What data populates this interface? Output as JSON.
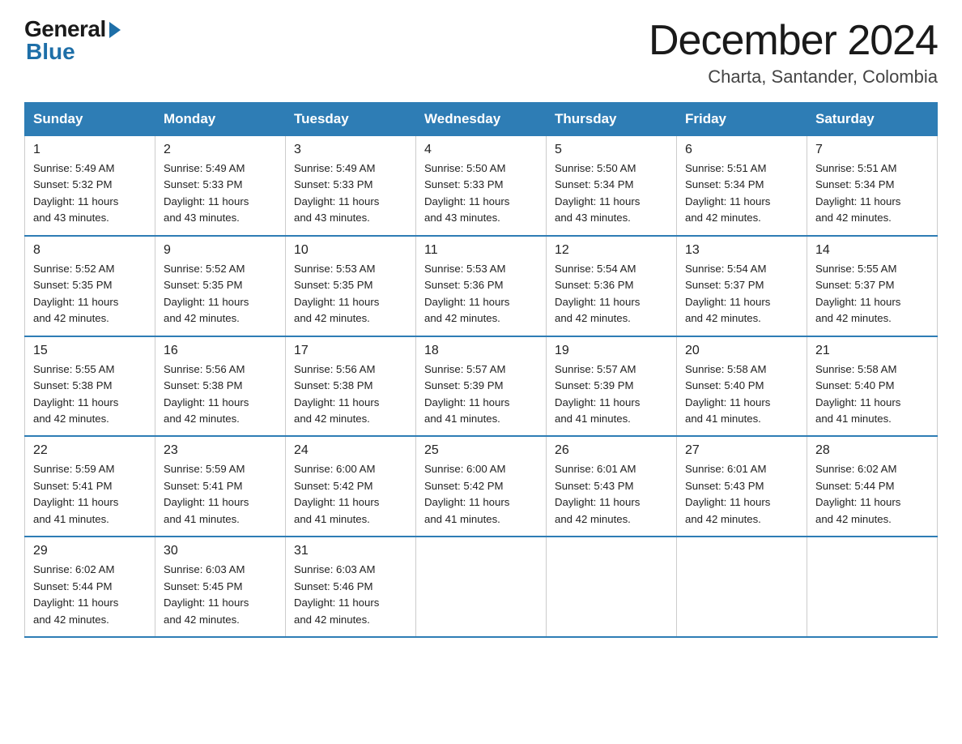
{
  "logo": {
    "general": "General",
    "blue": "Blue"
  },
  "title": "December 2024",
  "subtitle": "Charta, Santander, Colombia",
  "headers": [
    "Sunday",
    "Monday",
    "Tuesday",
    "Wednesday",
    "Thursday",
    "Friday",
    "Saturday"
  ],
  "weeks": [
    [
      {
        "day": "1",
        "sunrise": "5:49 AM",
        "sunset": "5:32 PM",
        "daylight": "11 hours and 43 minutes."
      },
      {
        "day": "2",
        "sunrise": "5:49 AM",
        "sunset": "5:33 PM",
        "daylight": "11 hours and 43 minutes."
      },
      {
        "day": "3",
        "sunrise": "5:49 AM",
        "sunset": "5:33 PM",
        "daylight": "11 hours and 43 minutes."
      },
      {
        "day": "4",
        "sunrise": "5:50 AM",
        "sunset": "5:33 PM",
        "daylight": "11 hours and 43 minutes."
      },
      {
        "day": "5",
        "sunrise": "5:50 AM",
        "sunset": "5:34 PM",
        "daylight": "11 hours and 43 minutes."
      },
      {
        "day": "6",
        "sunrise": "5:51 AM",
        "sunset": "5:34 PM",
        "daylight": "11 hours and 42 minutes."
      },
      {
        "day": "7",
        "sunrise": "5:51 AM",
        "sunset": "5:34 PM",
        "daylight": "11 hours and 42 minutes."
      }
    ],
    [
      {
        "day": "8",
        "sunrise": "5:52 AM",
        "sunset": "5:35 PM",
        "daylight": "11 hours and 42 minutes."
      },
      {
        "day": "9",
        "sunrise": "5:52 AM",
        "sunset": "5:35 PM",
        "daylight": "11 hours and 42 minutes."
      },
      {
        "day": "10",
        "sunrise": "5:53 AM",
        "sunset": "5:35 PM",
        "daylight": "11 hours and 42 minutes."
      },
      {
        "day": "11",
        "sunrise": "5:53 AM",
        "sunset": "5:36 PM",
        "daylight": "11 hours and 42 minutes."
      },
      {
        "day": "12",
        "sunrise": "5:54 AM",
        "sunset": "5:36 PM",
        "daylight": "11 hours and 42 minutes."
      },
      {
        "day": "13",
        "sunrise": "5:54 AM",
        "sunset": "5:37 PM",
        "daylight": "11 hours and 42 minutes."
      },
      {
        "day": "14",
        "sunrise": "5:55 AM",
        "sunset": "5:37 PM",
        "daylight": "11 hours and 42 minutes."
      }
    ],
    [
      {
        "day": "15",
        "sunrise": "5:55 AM",
        "sunset": "5:38 PM",
        "daylight": "11 hours and 42 minutes."
      },
      {
        "day": "16",
        "sunrise": "5:56 AM",
        "sunset": "5:38 PM",
        "daylight": "11 hours and 42 minutes."
      },
      {
        "day": "17",
        "sunrise": "5:56 AM",
        "sunset": "5:38 PM",
        "daylight": "11 hours and 42 minutes."
      },
      {
        "day": "18",
        "sunrise": "5:57 AM",
        "sunset": "5:39 PM",
        "daylight": "11 hours and 41 minutes."
      },
      {
        "day": "19",
        "sunrise": "5:57 AM",
        "sunset": "5:39 PM",
        "daylight": "11 hours and 41 minutes."
      },
      {
        "day": "20",
        "sunrise": "5:58 AM",
        "sunset": "5:40 PM",
        "daylight": "11 hours and 41 minutes."
      },
      {
        "day": "21",
        "sunrise": "5:58 AM",
        "sunset": "5:40 PM",
        "daylight": "11 hours and 41 minutes."
      }
    ],
    [
      {
        "day": "22",
        "sunrise": "5:59 AM",
        "sunset": "5:41 PM",
        "daylight": "11 hours and 41 minutes."
      },
      {
        "day": "23",
        "sunrise": "5:59 AM",
        "sunset": "5:41 PM",
        "daylight": "11 hours and 41 minutes."
      },
      {
        "day": "24",
        "sunrise": "6:00 AM",
        "sunset": "5:42 PM",
        "daylight": "11 hours and 41 minutes."
      },
      {
        "day": "25",
        "sunrise": "6:00 AM",
        "sunset": "5:42 PM",
        "daylight": "11 hours and 41 minutes."
      },
      {
        "day": "26",
        "sunrise": "6:01 AM",
        "sunset": "5:43 PM",
        "daylight": "11 hours and 42 minutes."
      },
      {
        "day": "27",
        "sunrise": "6:01 AM",
        "sunset": "5:43 PM",
        "daylight": "11 hours and 42 minutes."
      },
      {
        "day": "28",
        "sunrise": "6:02 AM",
        "sunset": "5:44 PM",
        "daylight": "11 hours and 42 minutes."
      }
    ],
    [
      {
        "day": "29",
        "sunrise": "6:02 AM",
        "sunset": "5:44 PM",
        "daylight": "11 hours and 42 minutes."
      },
      {
        "day": "30",
        "sunrise": "6:03 AM",
        "sunset": "5:45 PM",
        "daylight": "11 hours and 42 minutes."
      },
      {
        "day": "31",
        "sunrise": "6:03 AM",
        "sunset": "5:46 PM",
        "daylight": "11 hours and 42 minutes."
      },
      null,
      null,
      null,
      null
    ]
  ],
  "labels": {
    "sunrise": "Sunrise:",
    "sunset": "Sunset:",
    "daylight": "Daylight:"
  }
}
